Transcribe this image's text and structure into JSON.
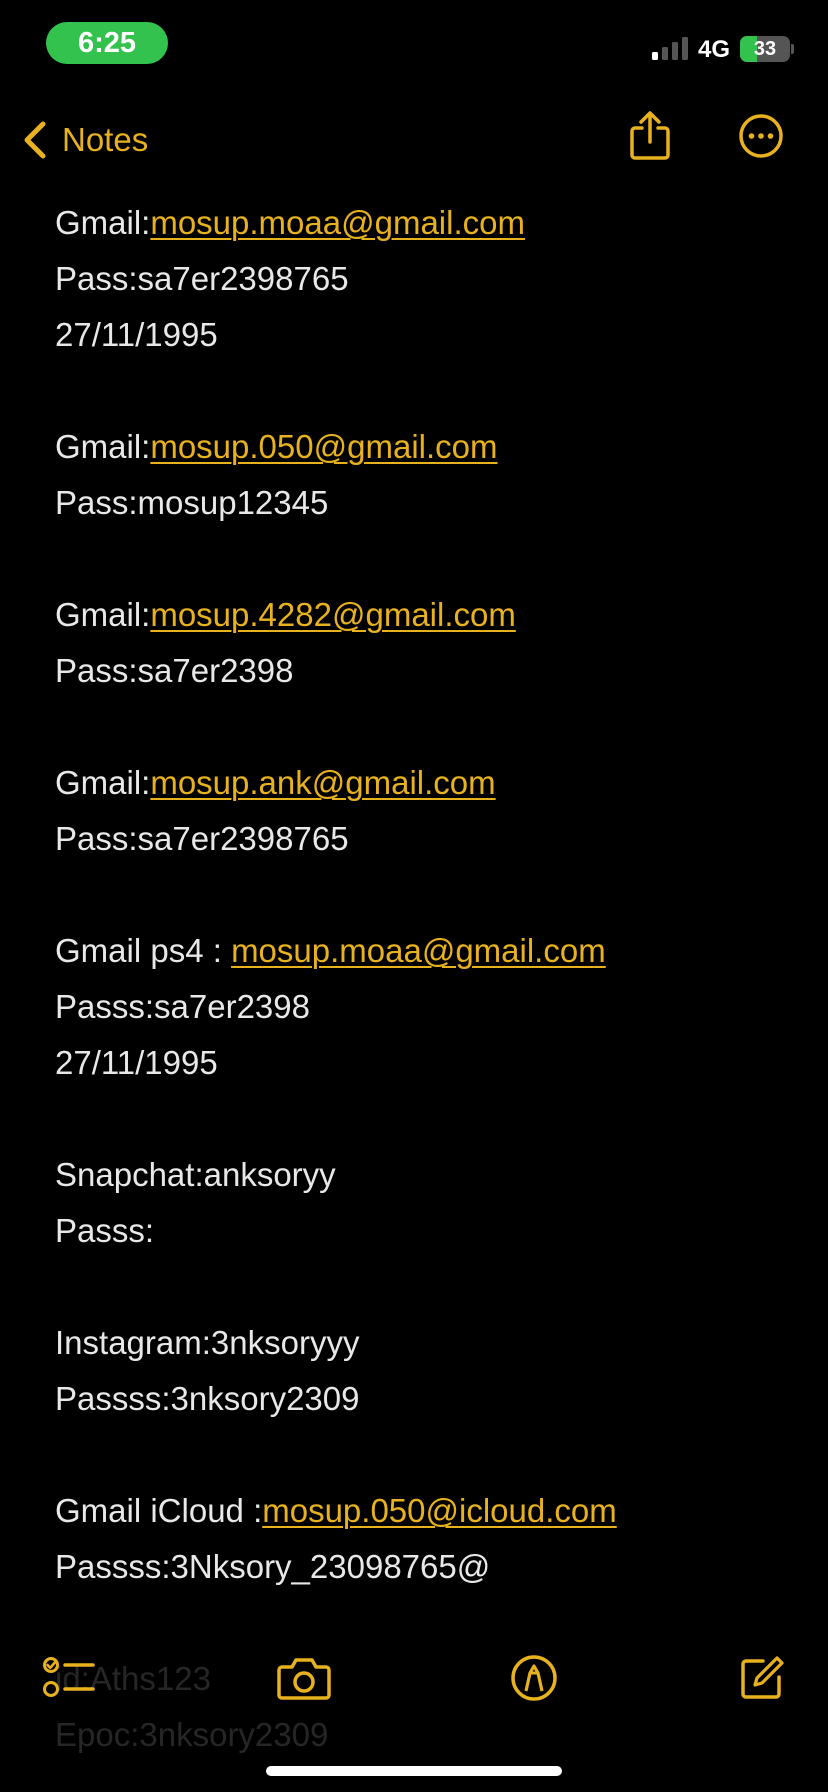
{
  "status_bar": {
    "time": "6:25",
    "network": "4G",
    "battery_level": "33",
    "battery_fraction": 0.33,
    "colors": {
      "time_pill": "#33c24d",
      "battery": "#33c24d"
    }
  },
  "nav": {
    "back_label": "Notes",
    "back_icon": "chevron-left-icon",
    "share_icon": "share-icon",
    "more_icon": "ellipsis-circle-icon",
    "accent_color": "#e8b21f"
  },
  "note": {
    "lines": {
      "l1_prefix": "Gmail:",
      "l1_link": "mosup.moaa@gmail.com",
      "l2": "Pass:sa7er2398765",
      "l3": "27/11/1995",
      "l5_prefix": "Gmail:",
      "l5_link": "mosup.050@gmail.com",
      "l6": "Pass:mosup12345",
      "l8_prefix": "Gmail:",
      "l8_link": "mosup.4282@gmail.com",
      "l9": "Pass:sa7er2398",
      "l11_prefix": "Gmail:",
      "l11_link": "mosup.ank@gmail.com",
      "l12": "Pass:sa7er2398765",
      "l14_prefix": "Gmail ps4 : ",
      "l14_link": "mosup.moaa@gmail.com",
      "l15": "Passs:sa7er2398",
      "l16": "27/11/1995",
      "l18": "Snapchat:anksoryy",
      "l19": "Passs:",
      "l21": "Instagram:3nksoryyy",
      "l22": "Passss:3nksory2309",
      "l24_prefix": "Gmail iCloud :",
      "l24_link": "mosup.050@icloud.com",
      "l25": "Passss:3Nksory_23098765@",
      "l27": "id:Aths123",
      "l28": "Epoc:3nksory2309"
    }
  },
  "toolbar": {
    "checklist_icon": "checklist-icon",
    "camera_icon": "camera-icon",
    "markup_icon": "markup-pen-icon",
    "compose_icon": "compose-icon"
  }
}
